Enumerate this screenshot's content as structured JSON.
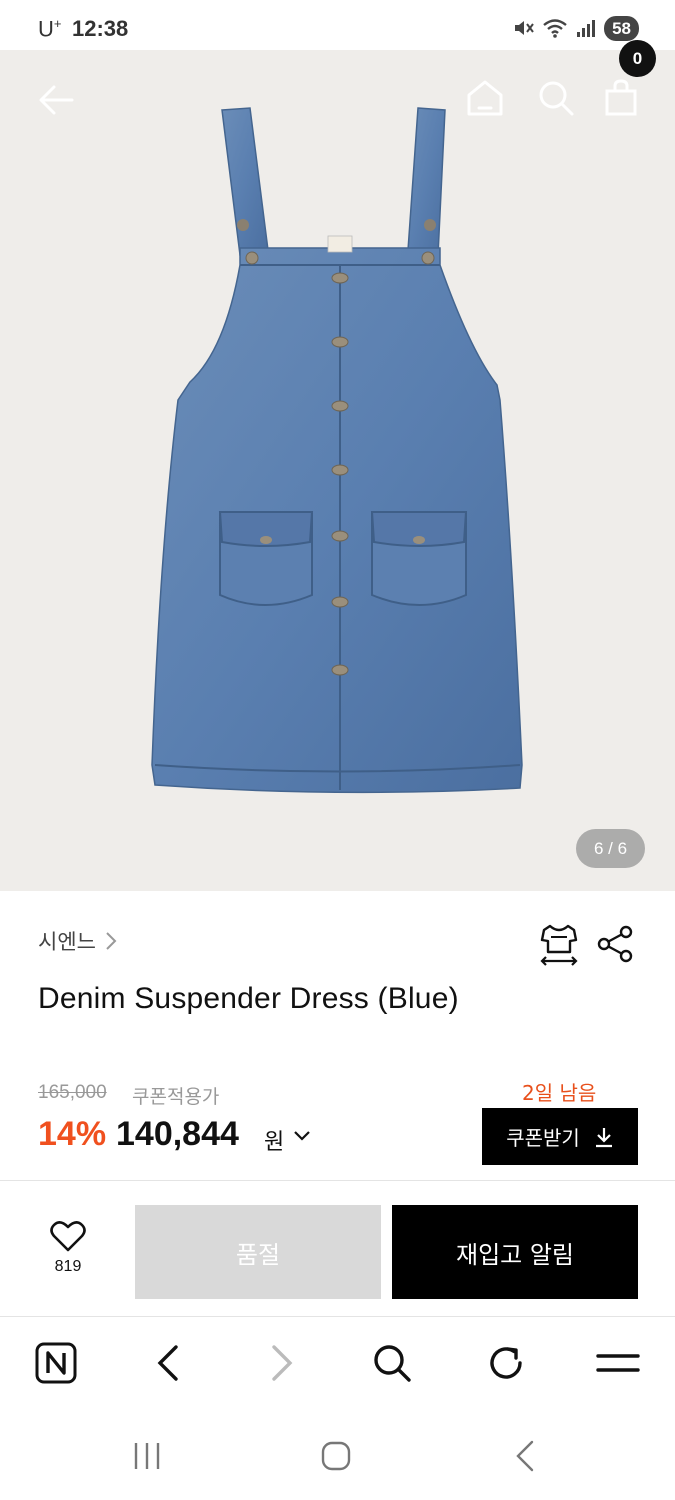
{
  "status_bar": {
    "carrier": "U",
    "carrier_sup": "+",
    "time": "12:38",
    "battery": "58",
    "icons": [
      "mute-icon",
      "wifi-icon",
      "signal-icon"
    ]
  },
  "hero": {
    "image_counter": "6 / 6",
    "cart_count": "0",
    "icons": [
      "back-arrow-icon",
      "home-icon",
      "search-icon",
      "shopping-bag-icon"
    ]
  },
  "product": {
    "brand": "시엔느",
    "title": "Denim Suspender Dress (Blue)",
    "original_price": "165,000",
    "coupon_label": "쿠폰적용가",
    "discount": "14%",
    "sale_price": "140,844",
    "currency": "원",
    "days_left": "2일 남음",
    "coupon_button": "쿠폰받기"
  },
  "actions": {
    "like_count": "819",
    "soldout": "품절",
    "restock": "재입고 알림"
  },
  "browser_toolbar": {
    "icons": [
      "naver-icon",
      "back-icon",
      "forward-icon",
      "search-icon",
      "refresh-icon",
      "menu-icon"
    ]
  },
  "android_nav": {
    "icons": [
      "recent-apps-icon",
      "home-icon",
      "back-icon"
    ]
  },
  "colors": {
    "accent_orange": "#f0501e",
    "black": "#000000",
    "soldout_gray": "#d9d9d9",
    "hero_bg": "#efedea"
  }
}
